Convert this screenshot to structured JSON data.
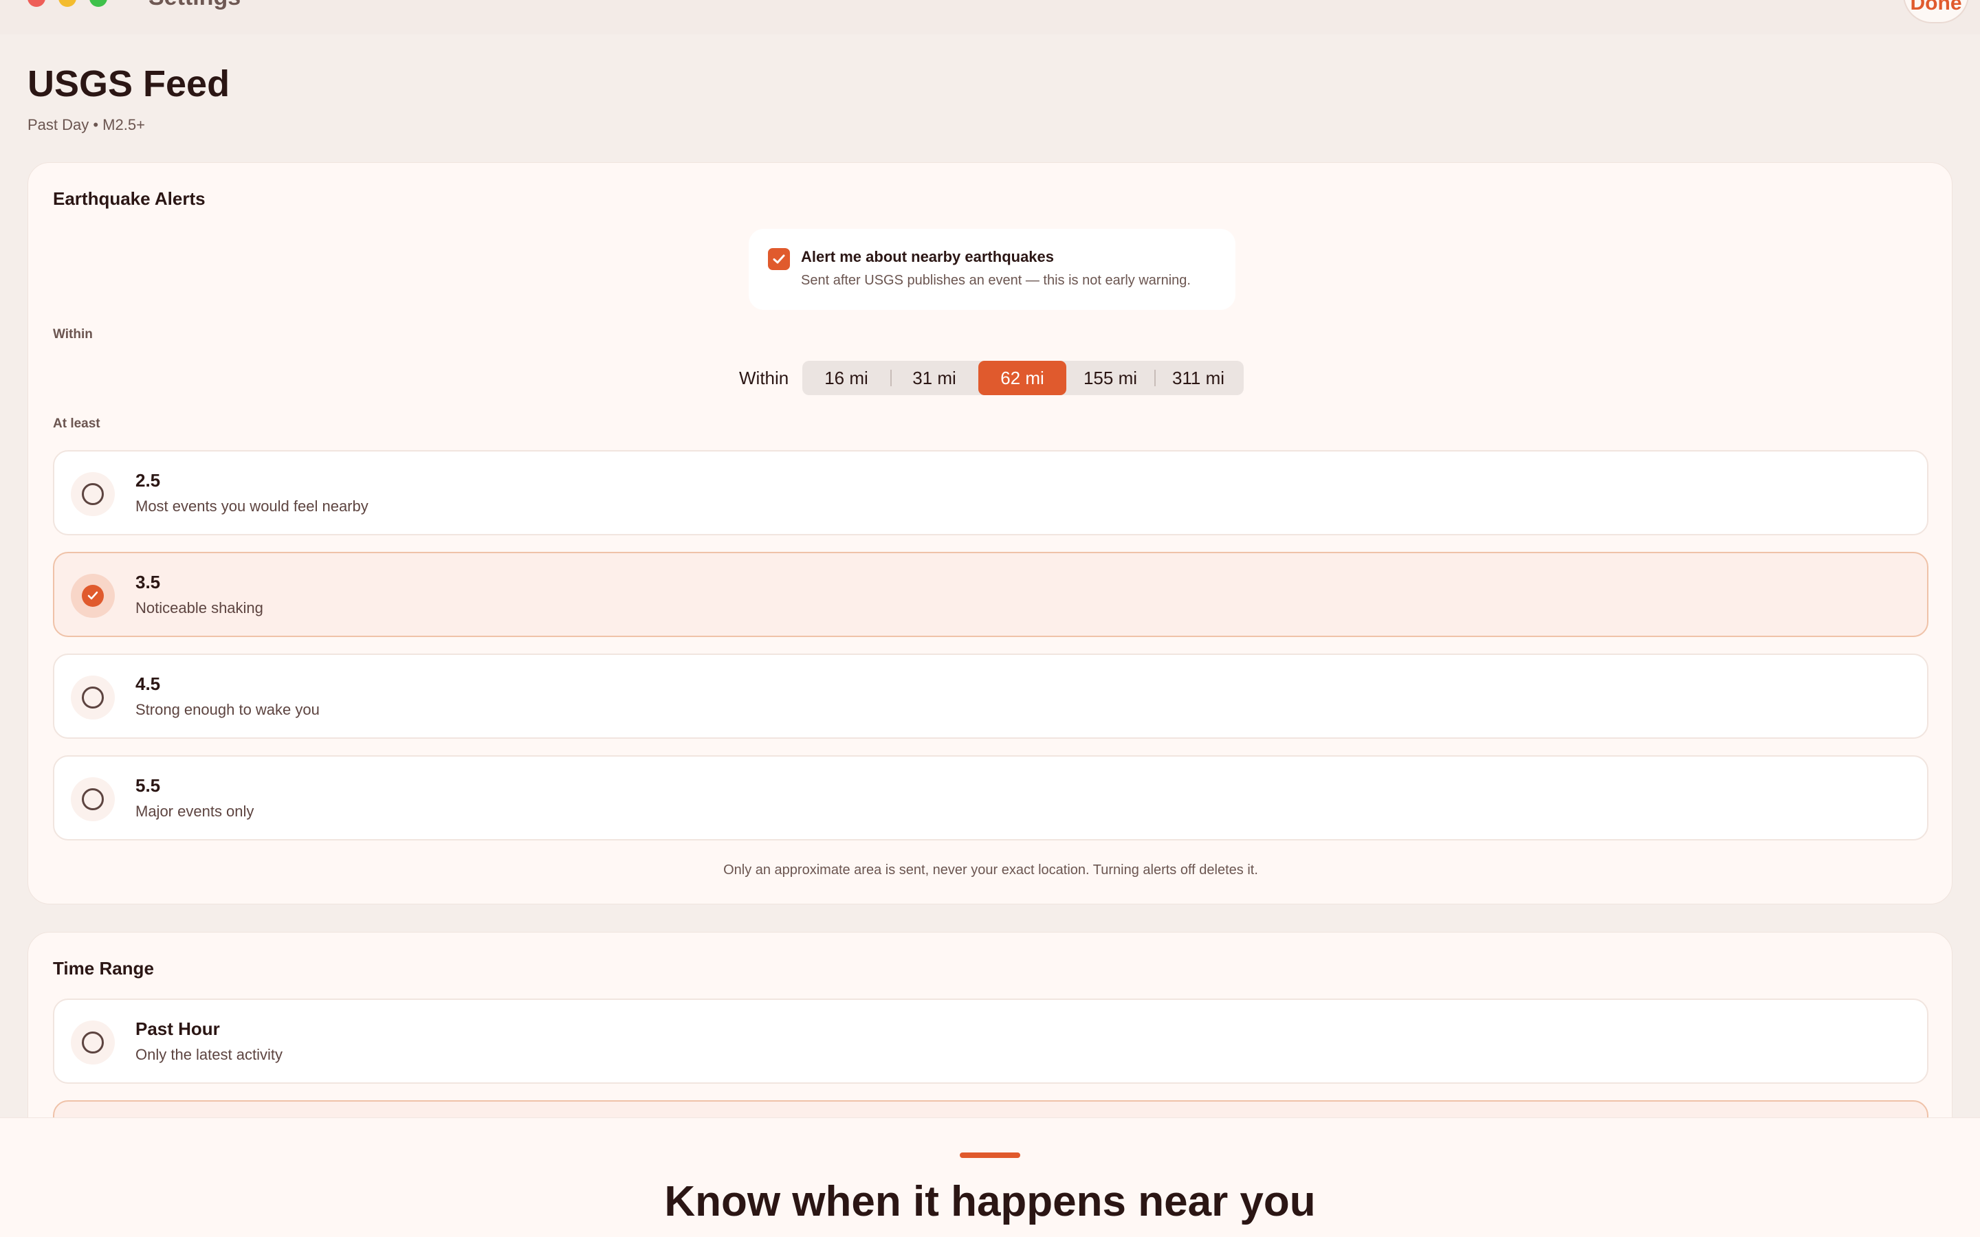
{
  "window": {
    "title": "Settings",
    "done_label": "Done"
  },
  "header": {
    "title": "USGS Feed",
    "subtitle": "Past Day • M2.5+"
  },
  "alerts": {
    "title": "Earthquake Alerts",
    "consent": {
      "checked": true,
      "label": "Alert me about nearby earthquakes",
      "detail": "Sent after USGS publishes an event — this is not early warning."
    },
    "within_section_label": "Within",
    "within_control_label": "Within",
    "distance_options": [
      "16 mi",
      "31 mi",
      "62 mi",
      "155 mi",
      "311 mi"
    ],
    "selected_distance": "62 mi",
    "magnitude_section_label": "At least",
    "magnitudes": [
      {
        "value": "2.5",
        "description": "Most events you would feel nearby",
        "selected": false
      },
      {
        "value": "3.5",
        "description": "Noticeable shaking",
        "selected": true
      },
      {
        "value": "4.5",
        "description": "Strong enough to wake you",
        "selected": false
      },
      {
        "value": "5.5",
        "description": "Major events only",
        "selected": false
      }
    ],
    "privacy_note": "Only an approximate area is sent, never your exact location. Turning alerts off deletes it."
  },
  "time_range": {
    "title": "Time Range",
    "options": [
      {
        "label": "Past Hour",
        "description": "Only the latest activity",
        "selected": false
      }
    ]
  },
  "promo": {
    "tagline": "Know when it happens near you"
  },
  "colors": {
    "accent": "#e05a2d",
    "background": "#f5eeea",
    "card": "#fff8f5",
    "text": "#2b1614"
  }
}
